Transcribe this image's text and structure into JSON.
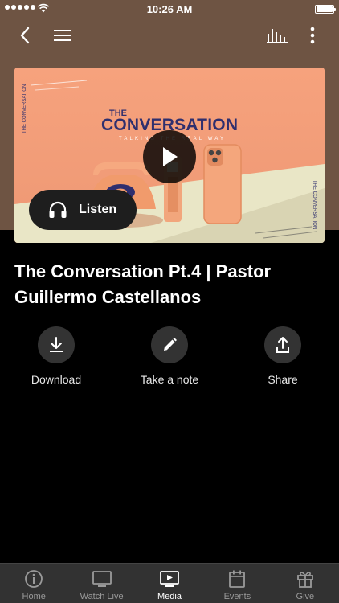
{
  "status_bar": {
    "time": "10:26 AM"
  },
  "nav": {
    "back_icon": "chevron-left-icon",
    "menu_icon": "hamburger-icon",
    "chart_icon": "audio-bars-icon",
    "more_icon": "more-vertical-icon"
  },
  "hero": {
    "artwork_title": "THE CONVERSATION",
    "artwork_title_top": "THE",
    "artwork_title_main": "CONVERSATION",
    "artwork_subtitle": "TALKING THE REAL WAY",
    "side_text_left": "THE CONVERSATION",
    "side_text_right": "THE CONVERSATION"
  },
  "listen_button": {
    "label": "Listen"
  },
  "episode": {
    "title": "The Conversation Pt.4 | Pastor Guillermo Castellanos"
  },
  "actions": [
    {
      "label": "Download",
      "icon": "download-icon"
    },
    {
      "label": "Take a note",
      "icon": "pencil-icon"
    },
    {
      "label": "Share",
      "icon": "share-icon"
    }
  ],
  "tabs": [
    {
      "label": "Home",
      "icon": "info-icon",
      "active": false
    },
    {
      "label": "Watch Live",
      "icon": "tv-icon",
      "active": false
    },
    {
      "label": "Media",
      "icon": "play-box-icon",
      "active": true
    },
    {
      "label": "Events",
      "icon": "calendar-icon",
      "active": false
    },
    {
      "label": "Give",
      "icon": "gift-icon",
      "active": false
    }
  ],
  "colors": {
    "header_bg": "#6e5443",
    "hero_bg": "#f2a07c",
    "accent_navy": "#2f2f6e"
  }
}
